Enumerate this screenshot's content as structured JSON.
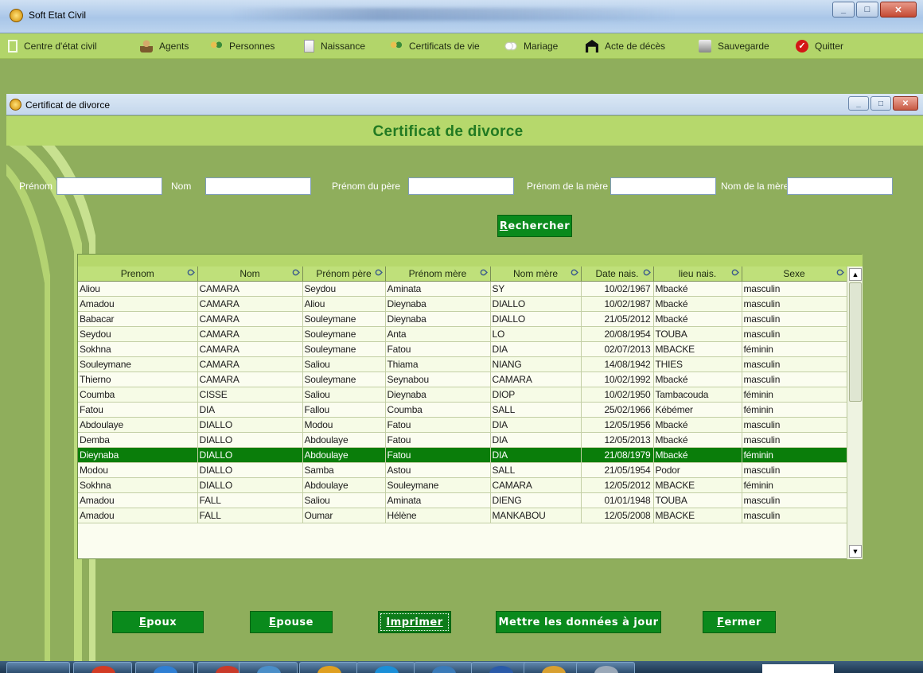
{
  "app": {
    "title": "Soft Etat Civil"
  },
  "menu": {
    "items": [
      {
        "label": "Centre d'état civil",
        "icon": "box-icon"
      },
      {
        "label": "Agents",
        "icon": "agent-icon"
      },
      {
        "label": "Personnes",
        "icon": "persons-icon"
      },
      {
        "label": "Naissance",
        "icon": "document-icon"
      },
      {
        "label": "Certificats de vie",
        "icon": "persons-icon"
      },
      {
        "label": "Mariage",
        "icon": "rings-icon"
      },
      {
        "label": "Acte de décès",
        "icon": "coffin-icon"
      },
      {
        "label": "Sauvegarde",
        "icon": "save-icon"
      },
      {
        "label": "Quitter",
        "icon": "quit-icon"
      }
    ]
  },
  "child_window": {
    "title": "Certificat de divorce"
  },
  "form": {
    "heading": "Certificat de divorce",
    "fields": {
      "prenom": {
        "label": "Prénom",
        "value": ""
      },
      "nom": {
        "label": "Nom",
        "value": ""
      },
      "prenom_pere": {
        "label": "Prénom du père",
        "value": ""
      },
      "prenom_mere": {
        "label": "Prénom de la mère",
        "value": ""
      },
      "nom_mere": {
        "label": "Nom de la mère",
        "value": ""
      }
    },
    "search_button": {
      "mnemonic": "R",
      "rest": "echercher"
    }
  },
  "grid": {
    "columns": [
      "Prenom",
      "Nom",
      "Prénom père",
      "Prénom mère",
      "Nom mère",
      "Date nais.",
      "lieu nais.",
      "Sexe"
    ],
    "selected_index": 11,
    "rows": [
      [
        "Aliou",
        "CAMARA",
        "Seydou",
        "Aminata",
        "SY",
        "10/02/1967",
        "Mbacké",
        "masculin"
      ],
      [
        "Amadou",
        "CAMARA",
        "Aliou",
        "Dieynaba",
        "DIALLO",
        "10/02/1987",
        "Mbacké",
        "masculin"
      ],
      [
        "Babacar",
        "CAMARA",
        "Souleymane",
        "Dieynaba",
        "DIALLO",
        "21/05/2012",
        "Mbacké",
        "masculin"
      ],
      [
        "Seydou",
        "CAMARA",
        "Souleymane",
        "Anta",
        "LO",
        "20/08/1954",
        "TOUBA",
        "masculin"
      ],
      [
        "Sokhna",
        "CAMARA",
        "Souleymane",
        "Fatou",
        "DIA",
        "02/07/2013",
        "MBACKE",
        "féminin"
      ],
      [
        "Souleymane",
        "CAMARA",
        "Saliou",
        "Thiama",
        "NIANG",
        "14/08/1942",
        "THIES",
        "masculin"
      ],
      [
        "Thierno",
        "CAMARA",
        "Souleymane",
        "Seynabou",
        "CAMARA",
        "10/02/1992",
        "Mbacké",
        "masculin"
      ],
      [
        "Coumba",
        "CISSE",
        "Saliou",
        "Dieynaba",
        "DIOP",
        "10/02/1950",
        "Tambacouda",
        "féminin"
      ],
      [
        "Fatou",
        "DIA",
        "Fallou",
        "Coumba",
        "SALL",
        "25/02/1966",
        "Kébémer",
        "féminin"
      ],
      [
        "Abdoulaye",
        "DIALLO",
        "Modou",
        "Fatou",
        "DIA",
        "12/05/1956",
        "Mbacké",
        "masculin"
      ],
      [
        "Demba",
        "DIALLO",
        "Abdoulaye",
        "Fatou",
        "DIA",
        "12/05/2013",
        "Mbacké",
        "masculin"
      ],
      [
        "Dieynaba",
        "DIALLO",
        "Abdoulaye",
        "Fatou",
        "DIA",
        "21/08/1979",
        "Mbacké",
        "féminin"
      ],
      [
        "Modou",
        "DIALLO",
        "Samba",
        "Astou",
        "SALL",
        "21/05/1954",
        "Podor",
        "masculin"
      ],
      [
        "Sokhna",
        "DIALLO",
        "Abdoulaye",
        "Souleymane",
        "CAMARA",
        "12/05/2012",
        "MBACKE",
        "féminin"
      ],
      [
        "Amadou",
        "FALL",
        "Saliou",
        "Aminata",
        "DIENG",
        "01/01/1948",
        "TOUBA",
        "masculin"
      ],
      [
        "Amadou",
        "FALL",
        "Oumar",
        "Hélène",
        "MANKABOU",
        "12/05/2008",
        "MBACKE",
        "masculin"
      ]
    ]
  },
  "buttons": {
    "epoux": {
      "mnemonic": "E",
      "rest": "poux"
    },
    "epouse": {
      "mnemonic": "E",
      "rest": "pouse"
    },
    "imprimer": {
      "mnemonic": "I",
      "rest": "mprimer"
    },
    "maj": {
      "label": "Mettre les données à jour"
    },
    "fermer": {
      "mnemonic": "F",
      "rest": "ermer"
    }
  },
  "colors": {
    "menu_bar": "#b2d56a",
    "background": "#8fae5c",
    "heading": "#227a22",
    "button": "#0a8a1c",
    "selected_row": "#0a7d0a"
  }
}
